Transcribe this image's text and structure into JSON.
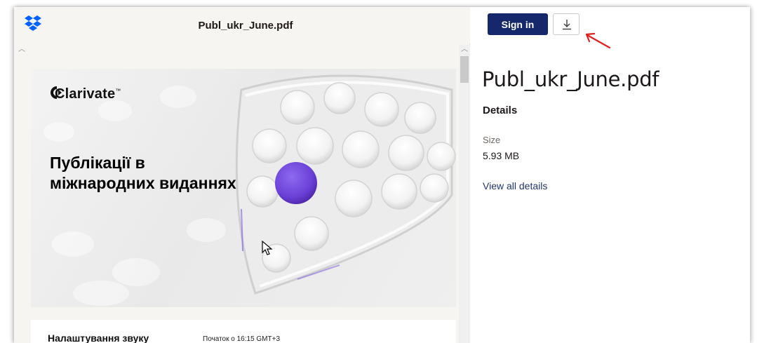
{
  "viewer": {
    "file_title": "Publ_ukr_June.pdf",
    "logo_icon": "dropbox-icon",
    "page1": {
      "brand": "Clarivate",
      "brand_tm": "™",
      "heading_line1": "Публікації в",
      "heading_line2": "міжнародних виданнях",
      "accent_color": "#6a3fd6"
    },
    "page2": {
      "left_text": "Налаштування звуку",
      "right_text": "Початок о 16:15 GMT+3"
    }
  },
  "panel": {
    "signin_label": "Sign in",
    "download_icon": "download-icon",
    "title": "Publ_ukr_June.pdf",
    "details_heading": "Details",
    "size_label": "Size",
    "size_value": "5.93 MB",
    "view_all_details": "View all details",
    "signin_color": "#15286b",
    "annotation_arrow_color": "#e02020"
  }
}
